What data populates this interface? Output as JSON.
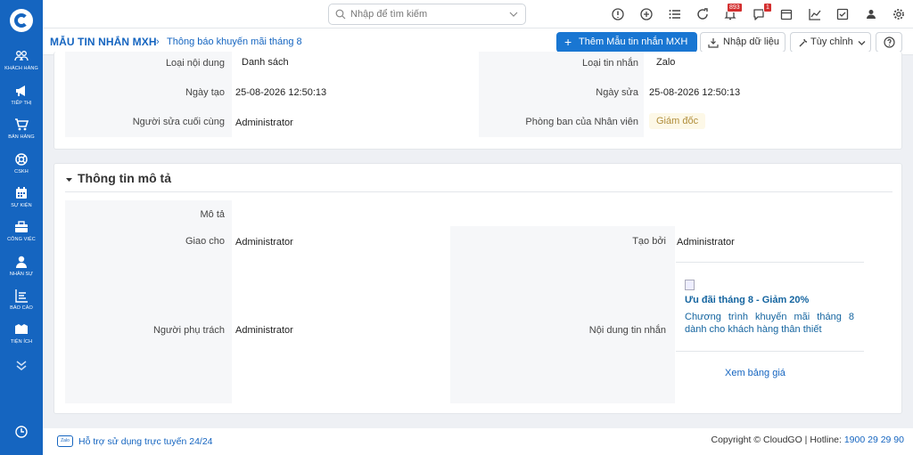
{
  "sidebar": {
    "items": [
      {
        "label": "KHÁCH HÀNG",
        "icon": "users-icon"
      },
      {
        "label": "TIẾP THỊ",
        "icon": "megaphone-icon"
      },
      {
        "label": "BÁN HÀNG",
        "icon": "cart-icon"
      },
      {
        "label": "CSKH",
        "icon": "lifebuoy-icon"
      },
      {
        "label": "SỰ KIỆN",
        "icon": "calendar-icon"
      },
      {
        "label": "CÔNG VIỆC",
        "icon": "briefcase-icon"
      },
      {
        "label": "NHÂN SỰ",
        "icon": "person-icon"
      },
      {
        "label": "BÁO CÁO",
        "icon": "report-icon"
      },
      {
        "label": "TIỆN ÍCH",
        "icon": "utilities-icon"
      }
    ]
  },
  "topbar": {
    "search_placeholder": "Nhập để tìm kiếm",
    "notification_count": "893",
    "chat_count": "1"
  },
  "header": {
    "module": "MẪU TIN NHẮN MXH",
    "breadcrumb": "Thông báo khuyến mãi tháng 8",
    "add_button": "Thêm Mẫu tin nhắn MXH",
    "import_button": "Nhập dữ liệu",
    "customize_button": "Tùy chỉnh"
  },
  "details": {
    "content_type_label": "Loại nội dung",
    "content_type_value": "Danh sách",
    "message_type_label": "Loại tin nhắn",
    "message_type_value": "Zalo",
    "created_label": "Ngày tạo",
    "created_value": "25-08-2026 12:50:13",
    "modified_label": "Ngày sửa",
    "modified_value": "25-08-2026 12:50:13",
    "last_modified_by_label": "Người sửa cuối cùng",
    "last_modified_by_value": "Administrator",
    "department_label": "Phòng ban của Nhân viên",
    "department_value": "Giám đốc"
  },
  "description": {
    "section_title": "Thông tin mô tả",
    "desc_label": "Mô tả",
    "assigned_label": "Giao cho",
    "assigned_value": "Administrator",
    "created_by_label": "Tạo bởi",
    "created_by_value": "Administrator",
    "owner_label": "Người phụ trách",
    "owner_value": "Administrator",
    "message_content_label": "Nội dung tin nhắn",
    "promo_title": "Ưu đãi tháng 8 - Giảm 20%",
    "promo_body": "Chương trình khuyến mãi tháng 8 dành cho khách hàng thân thiết",
    "price_link": "Xem bảng giá"
  },
  "footer": {
    "support": "Hỗ trợ sử dụng trực tuyến 24/24",
    "zalo_label": "Zalo",
    "copyright": "Copyright © CloudGO | Hotline: ",
    "hotline": "1900 29 29 90"
  },
  "colors": {
    "primary": "#1565c0",
    "badge": "#d32f2f",
    "tag_bg": "#fdf8e7"
  }
}
